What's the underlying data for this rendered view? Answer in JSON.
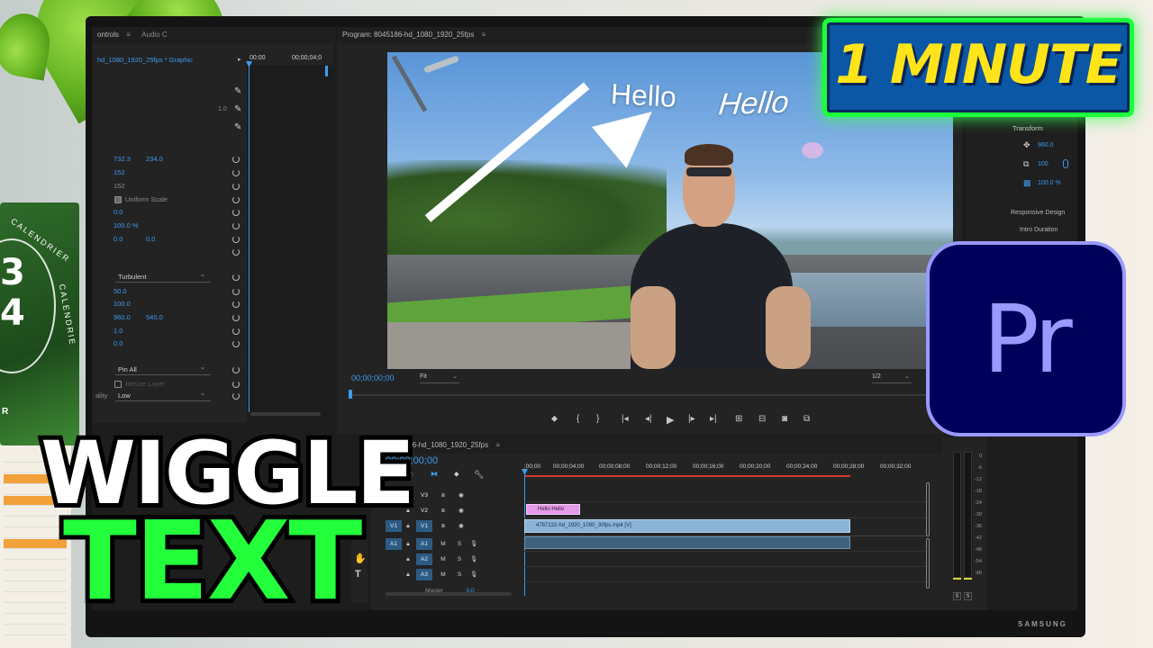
{
  "overlay": {
    "badge_text": "1 MINUTE",
    "headline_line1": "WIGGLE",
    "headline_line2": "TEXT",
    "logo_text": "Pr"
  },
  "monitor": {
    "brand": "SAMSUNG"
  },
  "background": {
    "calendar_text_1": "CALENDRIER",
    "calendar_text_2": "CALENDRIE",
    "calendar_digits_1": "3",
    "calendar_digits_2": "4",
    "calendar_letter": "R"
  },
  "effect_controls": {
    "tab_label": "ontrols",
    "tab2_label": "Audio C",
    "clip_label": "hd_1080_1920_25fps * Graphic",
    "timecode_start": "00:00",
    "timecode_end": "00;00;04;0",
    "scale_value": "1.0",
    "position_x": "732.3",
    "position_y": "234.0",
    "scale": "152",
    "scale_width": "152",
    "uniform_scale_label": "Uniform Scale",
    "rotation": "0.0",
    "opacity": "100.0 %",
    "anchor_x": "0.0",
    "anchor_y": "0.0",
    "turbulent_select": "Turbulent",
    "amount": "50.0",
    "size": "100.0",
    "offset_x": "960.0",
    "offset_y": "540.0",
    "complexity": "1.0",
    "evolution": "0.0",
    "pinning_select": "Pin All",
    "resize_layer_label": "Resize Layer",
    "quality_label": "ality",
    "quality_select": "Low"
  },
  "program_monitor": {
    "title": "Program: 8045186-hd_1080_1920_25fps",
    "video_text_1": "Hello",
    "video_text_2": "Hello",
    "timecode": "00;00;00;00",
    "fit_select": "Fit",
    "resolution_select": "1/2"
  },
  "essential_graphics": {
    "transform_label": "Transform",
    "position": "960.0",
    "scale": "100",
    "opacity": "100.0 %",
    "responsive_design_label": "Responsive Design",
    "intro_duration_label": "Intro Duration"
  },
  "timeline": {
    "sequence_title": "8045186-hd_1080_1920_25fps",
    "timecode": "00;00;00;00",
    "ruler": [
      ";00;00",
      "00;00;04;00",
      "00;00;08;00",
      "00;00;12;00",
      "00;00;16;00",
      "00;00;20;00",
      "00;00;24;00",
      "00;00;28;00",
      "00;00;32;00"
    ],
    "tracks": [
      {
        "name": "V3"
      },
      {
        "name": "V2"
      },
      {
        "name": "V1",
        "source": "V1"
      },
      {
        "name": "A1",
        "source": "A1"
      },
      {
        "name": "A2"
      },
      {
        "name": "A3"
      }
    ],
    "master_label": "Master",
    "master_value": "0.0",
    "graphic_clip": "Hello Hello",
    "video_clip": "4787132-hd_1920_1080_30fps.mp4 [V]",
    "m_label": "M",
    "s_label": "S"
  },
  "audio_meter": {
    "labels": [
      "0",
      "-6",
      "-12",
      "-18",
      "-24",
      "-30",
      "-36",
      "-42",
      "-48",
      "-54",
      "dB"
    ],
    "solo_left": "S",
    "solo_right": "S"
  }
}
